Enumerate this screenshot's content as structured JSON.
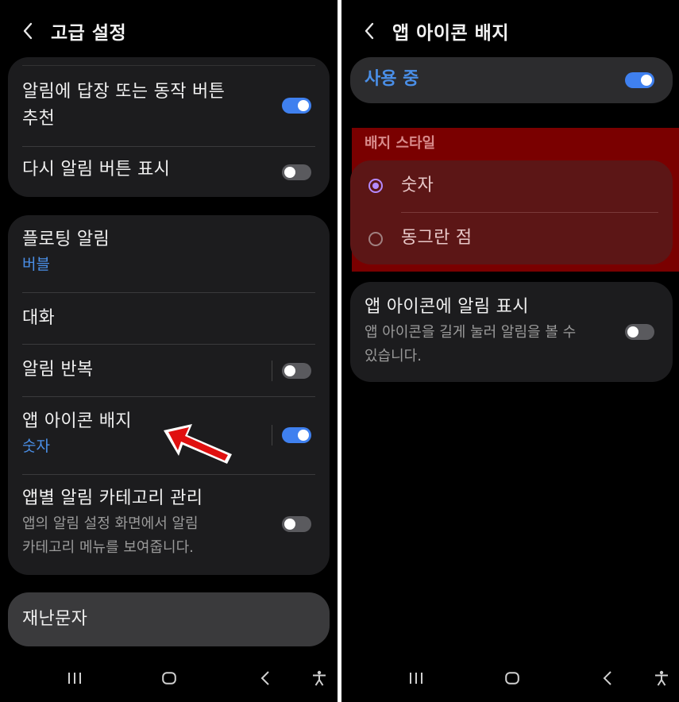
{
  "left": {
    "header": {
      "title": "고급 설정"
    },
    "card1": {
      "items": [
        {
          "title_line1": "알림에 답장 또는 동작 버튼",
          "title_line2": "추천",
          "toggle": "on"
        },
        {
          "title": "다시 알림 버튼 표시",
          "toggle": "off"
        }
      ]
    },
    "card2": {
      "floating": {
        "title": "플로팅 알림",
        "value": "버블"
      },
      "conversation": {
        "title": "대화"
      },
      "repeat": {
        "title": "알림 반복",
        "toggle": "off"
      },
      "badge": {
        "title": "앱 아이콘 배지",
        "value": "숫자",
        "toggle": "on"
      },
      "per_app": {
        "title": "앱별 알림 카테고리 관리",
        "desc_line1": "앱의 알림 설정 화면에서 알림",
        "desc_line2": "카테고리 메뉴를 보여줍니다.",
        "toggle": "off"
      }
    },
    "card3": {
      "title": "재난문자"
    }
  },
  "right": {
    "header": {
      "title": "앱 아이콘 배지"
    },
    "in_use": {
      "label": "사용 중",
      "toggle": "on"
    },
    "badge_style": {
      "section_label": "배지 스타일",
      "options": [
        {
          "label": "숫자",
          "selected": true
        },
        {
          "label": "동그란 점",
          "selected": false
        }
      ]
    },
    "show_on_icon": {
      "title": "앱 아이콘에 알림 표시",
      "desc_line1": "앱 아이콘을 길게 눌러 알림을 볼 수",
      "desc_line2": "있습니다.",
      "toggle": "off"
    }
  },
  "navbar": {
    "icons": [
      "recent-apps-icon",
      "home-icon",
      "back-icon",
      "accessibility-icon"
    ]
  },
  "colors": {
    "accent_blue": "#3f80ef",
    "highlight_red": "#7a0000",
    "annotation_arrow": "#e01010"
  }
}
